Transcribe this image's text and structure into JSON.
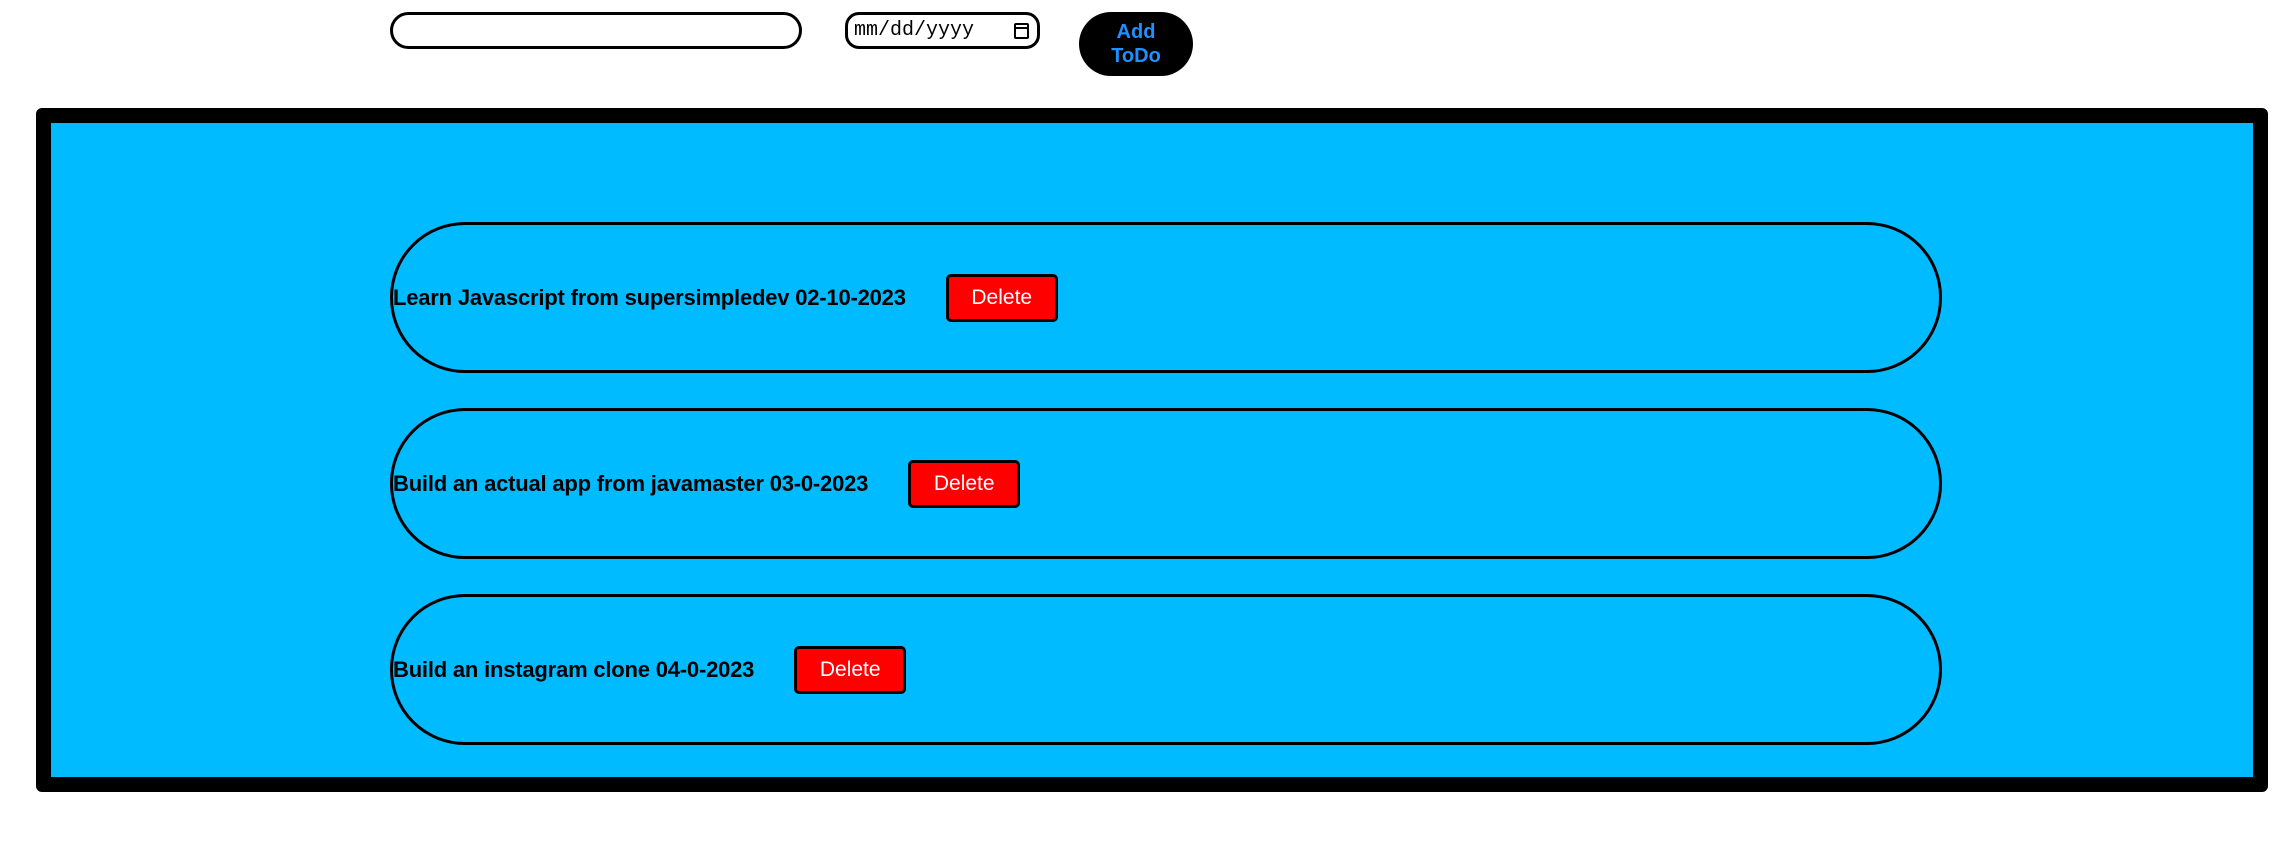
{
  "header": {
    "todo_input": {
      "value": "",
      "placeholder": ""
    },
    "date_input": {
      "value": "mm/dd/yyyy"
    },
    "add_button_label": "Add ToDo"
  },
  "todos": [
    {
      "text": "Learn Javascript from supersimpledev 02-10-2023",
      "delete_label": "Delete"
    },
    {
      "text": "Build an actual app from javamaster 03-0-2023",
      "delete_label": "Delete"
    },
    {
      "text": "Build an instagram clone 04-0-2023",
      "delete_label": "Delete"
    }
  ],
  "colors": {
    "panel_background": "#00bbff",
    "delete_button": "#ff0000",
    "add_button_background": "#000000",
    "add_button_text": "#1e90ff"
  }
}
